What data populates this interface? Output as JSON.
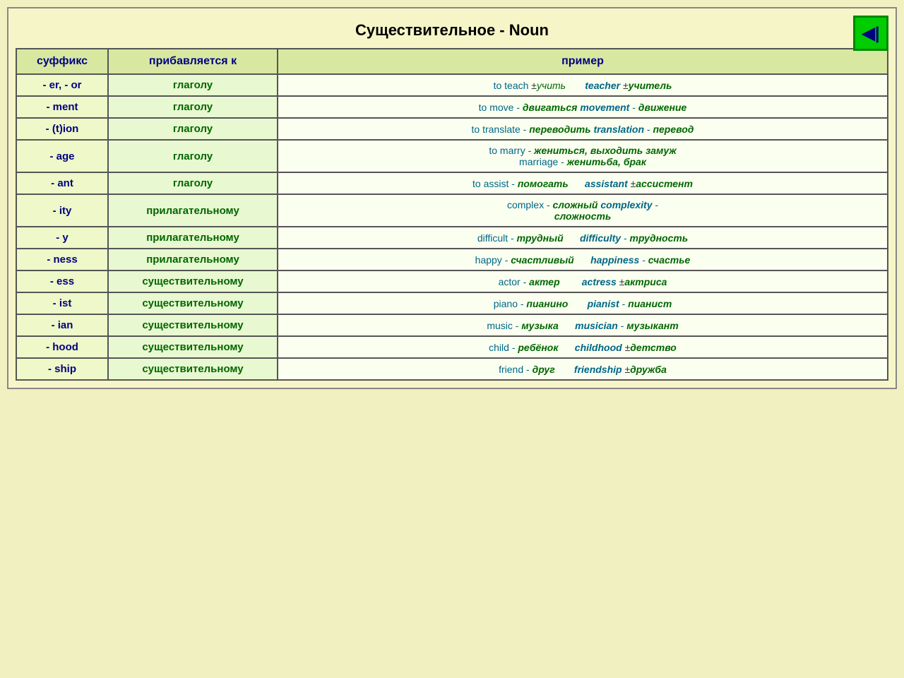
{
  "title": "Существительное - Noun",
  "nav_button_label": "◀|",
  "headers": {
    "col1": "суффикс",
    "col2": "прибавляется к",
    "col3": "пример"
  },
  "rows": [
    {
      "suffix": "- er, - or",
      "added_to": "глаголу",
      "example_html": "er_or"
    },
    {
      "suffix": "- ment",
      "added_to": "глаголу",
      "example_html": "ment"
    },
    {
      "suffix": "- (t)ion",
      "added_to": "глаголу",
      "example_html": "tion"
    },
    {
      "suffix": "- age",
      "added_to": "глаголу",
      "example_html": "age"
    },
    {
      "suffix": "- ant",
      "added_to": "глаголу",
      "example_html": "ant"
    },
    {
      "suffix": "- ity",
      "added_to": "прилагательному",
      "example_html": "ity"
    },
    {
      "suffix": "- y",
      "added_to": "прилагательному",
      "example_html": "y"
    },
    {
      "suffix": "- ness",
      "added_to": "прилагательному",
      "example_html": "ness"
    },
    {
      "suffix": "- ess",
      "added_to": "существительному",
      "example_html": "ess"
    },
    {
      "suffix": "- ist",
      "added_to": "существительному",
      "example_html": "ist"
    },
    {
      "suffix": "- ian",
      "added_to": "существительному",
      "example_html": "ian"
    },
    {
      "suffix": "- hood",
      "added_to": "существительному",
      "example_html": "hood"
    },
    {
      "suffix": "- ship",
      "added_to": "существительному",
      "example_html": "ship"
    }
  ]
}
